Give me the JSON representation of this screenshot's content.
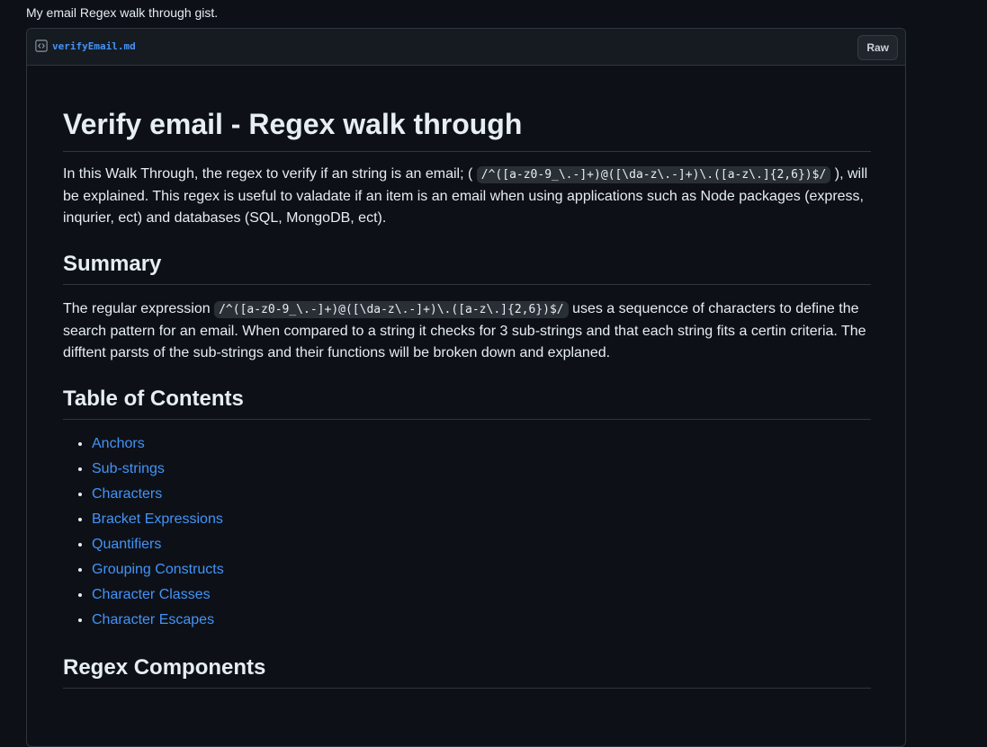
{
  "gist": {
    "description": "My email Regex walk through gist."
  },
  "file": {
    "name": "verifyEmail.md",
    "raw_label": "Raw",
    "icon": "code-square-icon"
  },
  "doc": {
    "title": "Verify email - Regex walk through",
    "intro": {
      "before": "In this Walk Through, the regex to verify if an string is an email; (",
      "code": "/^([a-z0-9_\\.-]+)@([\\da-z\\.-]+)\\.([a-z\\.]{2,6})$/",
      "after": "), will be explained. This regex is useful to valadate if an item is an email when using applications such as Node packages (express, inqurier, ect) and databases (SQL, MongoDB, ect)."
    },
    "summary_heading": "Summary",
    "summary": {
      "before": "The regular expression",
      "code": "/^([a-z0-9_\\.-]+)@([\\da-z\\.-]+)\\.([a-z\\.]{2,6})$/",
      "after": "uses a sequencce of characters to define the search pattern for an email. When compared to a string it checks for 3 sub-strings and that each string fits a certin criteria. The difftent parsts of the sub-strings and their functions will be broken down and explaned."
    },
    "toc_heading": "Table of Contents",
    "toc": [
      "Anchors",
      "Sub-strings",
      "Characters",
      "Bracket Expressions",
      "Quantifiers",
      "Grouping Constructs",
      "Character Classes",
      "Character Escapes"
    ],
    "components_heading": "Regex Components"
  },
  "colors": {
    "background": "#0d1117",
    "link": "#4493f8",
    "border": "#30363d",
    "text": "#e6edf3"
  }
}
